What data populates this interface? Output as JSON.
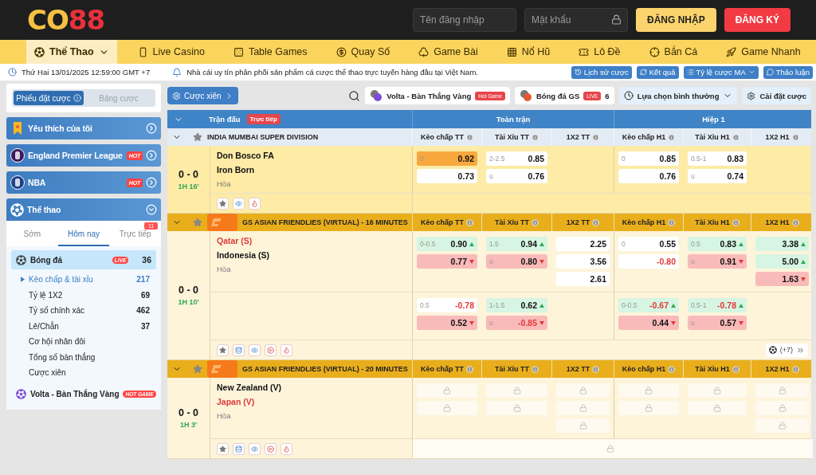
{
  "header": {
    "logo": [
      "CO",
      "88"
    ],
    "username": {
      "placeholder": "Tên đăng nhập"
    },
    "password": {
      "placeholder": "Mật khẩu"
    },
    "buttons": [
      {
        "label": "ĐĂNG NHẬP",
        "kind": "login"
      },
      {
        "label": "ĐĂNG KÝ",
        "kind": "register"
      }
    ]
  },
  "nav": [
    {
      "label": "Thể Thao",
      "selected": true
    },
    {
      "label": "Live Casino",
      "selected": false
    },
    {
      "label": "Table Games",
      "selected": false
    },
    {
      "label": "Quay Số",
      "selected": false
    },
    {
      "label": "Game Bài",
      "selected": false
    },
    {
      "label": "Nổ Hũ",
      "selected": false
    },
    {
      "label": "Lô Đề",
      "selected": false
    },
    {
      "label": "Bắn Cá",
      "selected": false
    },
    {
      "label": "Game Nhanh",
      "selected": false
    }
  ],
  "info_bar": {
    "datetime": "Thứ Hai 13/01/2025 12:59:00 GMT +7",
    "notice": "Nhà cái uy tín phân phối sản phẩm cá cược thể thao trực tuyến hàng đầu tại Việt Nam.",
    "buttons": [
      "Lịch sử cược",
      "Kết quả",
      "Tỷ lệ cược MA",
      "Thảo luận"
    ]
  },
  "sidebar": {
    "slip_tabs": [
      {
        "label": "Phiếu đặt cược",
        "selected": true
      },
      {
        "label": "Bảng cược",
        "selected": false
      }
    ],
    "menu": [
      {
        "label": "Yêu thích của tôi",
        "expanded": false
      },
      {
        "label": "England Premier League",
        "badge": "HOT",
        "expanded": false
      },
      {
        "label": "NBA",
        "badge": "HOT",
        "expanded": false
      },
      {
        "label": "Thể thao",
        "expanded": true
      }
    ],
    "sport_tabs": [
      {
        "label": "Sớm",
        "selected": false
      },
      {
        "label": "Hôm nay",
        "selected": true
      },
      {
        "label": "Trực tiếp",
        "selected": false,
        "badge": "11"
      }
    ],
    "sports": [
      {
        "label": "Bóng đá",
        "badge": "LIVE",
        "count": "36",
        "selected": true,
        "children": [
          {
            "label": "Kèo chấp & tài xỉu",
            "count": "217",
            "selected": true
          },
          {
            "label": "Tỷ lệ 1X2",
            "count": "69",
            "selected": false
          },
          {
            "label": "Tỷ số chính xác",
            "count": "462",
            "selected": false
          },
          {
            "label": "Lẻ/Chẵn",
            "count": "37",
            "selected": false
          },
          {
            "label": "Cơ hội nhân đôi",
            "selected": false
          },
          {
            "label": "Tổng số bàn thắng",
            "selected": false
          },
          {
            "label": "Cược xiên",
            "selected": false
          }
        ]
      },
      {
        "label": "Volta - Bàn Thắng Vàng",
        "badge": "HOT GAME",
        "selected": false
      }
    ]
  },
  "toolbar": {
    "parlay": "Cược xiên",
    "chips": [
      {
        "label": "Volta - Bàn Thắng Vàng",
        "badge": "Hot Game"
      },
      {
        "label": "Bóng đá GS",
        "badge": "LIVE",
        "count": "6"
      }
    ],
    "mode": "Lựa chọn bình thường",
    "settings": "Cài đặt cược"
  },
  "table": {
    "match_header": "Trận đấu",
    "live_badge": "Trực tiếp",
    "groups": [
      "Toàn trận",
      "Hiệp 1"
    ],
    "leagues": [
      {
        "name": "INDIA MUMBAI SUPER DIVISION",
        "kind": "regular",
        "columns": [
          "Kèo chấp TT",
          "Tài Xỉu TT",
          "1X2 TT",
          "Kèo chấp H1",
          "Tài Xỉu H1",
          "1X2 H1"
        ],
        "matches": [
          {
            "score": "0 - 0",
            "time": "1H 16'",
            "teams": [
              {
                "name": "Don Bosco FA",
                "favorite": false
              },
              {
                "name": "Iron Born",
                "favorite": false
              }
            ],
            "draw": "Hòa",
            "lines": [
              {
                "handicap_ft": [
                  {
                    "label": "0",
                    "value": "0.92",
                    "kind": "picked",
                    "negative": false
                  },
                  {
                    "value": "0.73",
                    "kind": "plain",
                    "negative": false
                  }
                ],
                "total_ft": [
                  {
                    "label": "2-2.5",
                    "value": "0.85",
                    "kind": "plain",
                    "negative": false
                  },
                  {
                    "label": "u",
                    "value": "0.76",
                    "kind": "plain",
                    "negative": false
                  }
                ],
                "handicap_h1": [
                  {
                    "label": "0",
                    "value": "0.85",
                    "kind": "plain",
                    "negative": false
                  },
                  {
                    "value": "0.76",
                    "kind": "plain",
                    "negative": false
                  }
                ],
                "total_h1": [
                  {
                    "label": "0.5-1",
                    "value": "0.83",
                    "kind": "plain",
                    "negative": false
                  },
                  {
                    "label": "u",
                    "value": "0.74",
                    "kind": "plain",
                    "negative": false
                  }
                ]
              }
            ],
            "has_stats": false,
            "has_video": false,
            "markets_locked": false
          }
        ]
      },
      {
        "name": "GS ASIAN FRIENDLIES (VIRTUAL) - 16 MINUTES",
        "kind": "virtual",
        "columns": [
          "Kèo chấp TT",
          "Tài Xỉu TT",
          "1X2 TT",
          "Kèo chấp H1",
          "Tài Xỉu H1",
          "1X2 H1"
        ],
        "matches": [
          {
            "score": "0 - 0",
            "time": "1H 10'",
            "teams": [
              {
                "name": "Qatar (S)",
                "favorite": true
              },
              {
                "name": "Indonesia (S)",
                "favorite": false
              }
            ],
            "draw": "Hòa",
            "lines": [
              {
                "handicap_ft": [
                  {
                    "label": "0-0.5",
                    "value": "0.90",
                    "kind": "up",
                    "negative": false
                  },
                  {
                    "value": "0.77",
                    "kind": "down",
                    "negative": false
                  }
                ],
                "total_ft": [
                  {
                    "label": "1.5",
                    "value": "0.94",
                    "kind": "up",
                    "negative": false
                  },
                  {
                    "label": "u",
                    "value": "0.80",
                    "kind": "down",
                    "negative": false
                  }
                ],
                "result_ft": [
                  {
                    "value": "2.25",
                    "kind": "plain",
                    "negative": false
                  },
                  {
                    "value": "3.56",
                    "kind": "plain",
                    "negative": false
                  },
                  {
                    "value": "2.61",
                    "kind": "plain",
                    "negative": false
                  }
                ],
                "handicap_h1": [
                  {
                    "label": "0",
                    "value": "0.55",
                    "kind": "plain",
                    "negative": false
                  },
                  {
                    "value": "-0.80",
                    "kind": "plain",
                    "negative": true
                  }
                ],
                "total_h1": [
                  {
                    "label": "0.5",
                    "value": "0.83",
                    "kind": "up",
                    "negative": false
                  },
                  {
                    "label": "u",
                    "value": "0.91",
                    "kind": "down",
                    "negative": false
                  }
                ],
                "result_h1": [
                  {
                    "value": "3.38",
                    "kind": "up",
                    "negative": false
                  },
                  {
                    "value": "5.00",
                    "kind": "up",
                    "negative": false
                  },
                  {
                    "value": "1.63",
                    "kind": "down",
                    "negative": false
                  }
                ]
              },
              {
                "handicap_ft": [
                  {
                    "label": "0.5",
                    "value": "-0.78",
                    "kind": "plain",
                    "negative": true
                  },
                  {
                    "value": "0.52",
                    "kind": "down",
                    "negative": false
                  }
                ],
                "total_ft": [
                  {
                    "label": "1-1.5",
                    "value": "0.62",
                    "kind": "up",
                    "negative": false
                  },
                  {
                    "label": "u",
                    "value": "-0.85",
                    "kind": "down",
                    "negative": true
                  }
                ],
                "handicap_h1": [
                  {
                    "label": "0-0.5",
                    "value": "-0.67",
                    "kind": "up",
                    "negative": true
                  },
                  {
                    "value": "0.44",
                    "kind": "down",
                    "negative": false
                  }
                ],
                "total_h1": [
                  {
                    "label": "0.5-1",
                    "value": "-0.78",
                    "kind": "up",
                    "negative": true
                  },
                  {
                    "label": "u",
                    "value": "0.57",
                    "kind": "down",
                    "negative": false
                  }
                ]
              }
            ],
            "has_stats": true,
            "has_video": true,
            "more": "(+7)",
            "markets_locked": false
          }
        ]
      },
      {
        "name": "GS ASIAN FRIENDLIES (VIRTUAL) - 20 MINUTES",
        "kind": "virtual",
        "columns": [
          "Kèo chấp TT",
          "Tài Xỉu TT",
          "1X2 TT",
          "Kèo chấp H1",
          "Tài Xỉu H1",
          "1X2 H1"
        ],
        "matches": [
          {
            "score": "0 - 0",
            "time": "1H 3'",
            "teams": [
              {
                "name": "New Zealand (V)",
                "favorite": false
              },
              {
                "name": "Japan (V)",
                "favorite": true
              }
            ],
            "draw": "Hòa",
            "lines": [
              {
                "handicap_ft": [
                  {
                    "kind": "locked"
                  },
                  {
                    "kind": "locked"
                  }
                ],
                "total_ft": [
                  {
                    "kind": "locked"
                  },
                  {
                    "kind": "locked"
                  }
                ],
                "result_ft": [
                  {
                    "kind": "locked"
                  },
                  {
                    "kind": "locked"
                  },
                  {
                    "kind": "locked"
                  }
                ],
                "handicap_h1": [
                  {
                    "kind": "locked"
                  },
                  {
                    "kind": "locked"
                  }
                ],
                "total_h1": [
                  {
                    "kind": "locked"
                  },
                  {
                    "kind": "locked"
                  }
                ],
                "result_h1": [
                  {
                    "kind": "locked"
                  },
                  {
                    "kind": "locked"
                  },
                  {
                    "kind": "locked"
                  }
                ]
              }
            ],
            "has_stats": true,
            "has_video": true,
            "markets_locked": true
          }
        ]
      }
    ]
  }
}
